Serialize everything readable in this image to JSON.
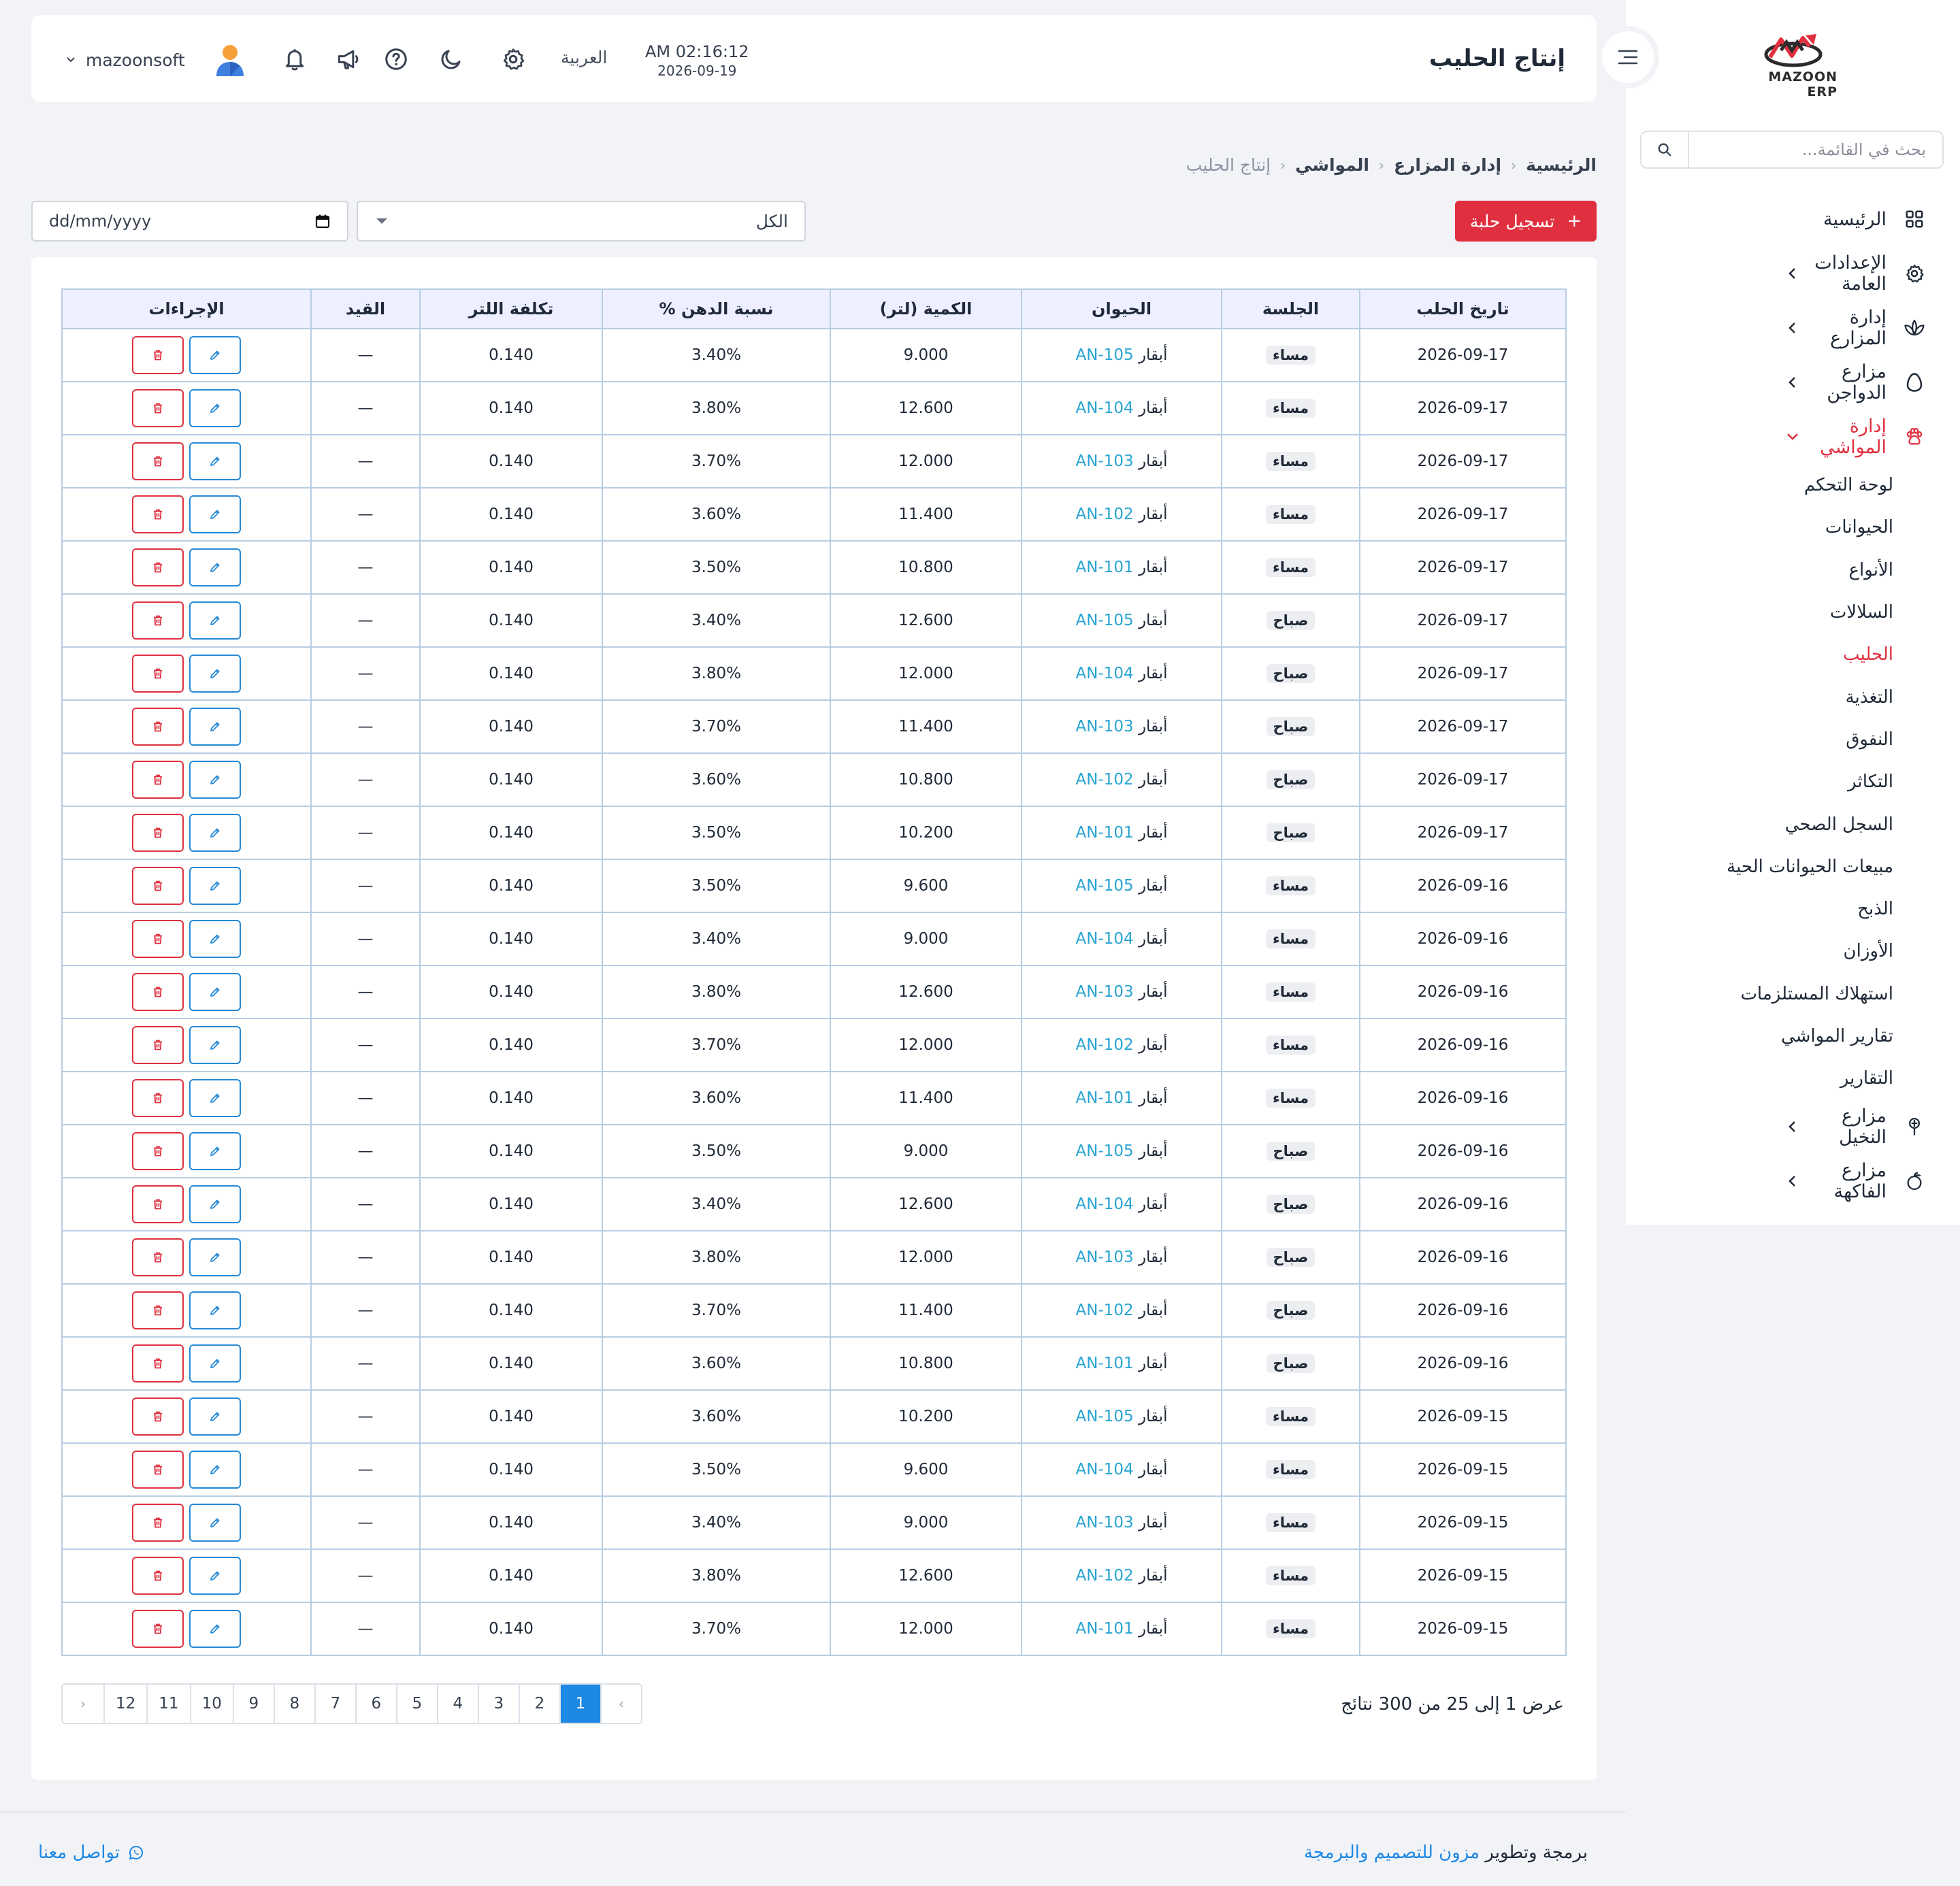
{
  "brand": {
    "logo_text": "MAZOON ERP"
  },
  "header": {
    "title": "إنتاج الحليب",
    "time": "AM 02:16:12",
    "date": "2026-09-19",
    "language": "العربية",
    "username": "mazoonsoft"
  },
  "sidebar": {
    "search_placeholder": "بحث في القائمة...",
    "items": [
      {
        "label": "الرئيسية",
        "icon": "grid-icon"
      },
      {
        "label": "الإعدادات العامة",
        "icon": "gear-icon"
      },
      {
        "label": "إدارة المزارع",
        "icon": "plant-icon"
      },
      {
        "label": "مزارع الدواجن",
        "icon": "egg-icon"
      },
      {
        "label": "إدارة المواشي",
        "icon": "paw-icon"
      },
      {
        "label": "مزارع النخيل",
        "icon": "palm-icon"
      },
      {
        "label": "مزارع الفاكهة",
        "icon": "fruit-icon"
      }
    ],
    "subitems": [
      "لوحة التحكم",
      "الحيوانات",
      "الأنواع",
      "السلالات",
      "الحليب",
      "التغذية",
      "النفوق",
      "التكاثر",
      "السجل الصحي",
      "مبيعات الحيوانات الحية",
      "الذبح",
      "الأوزان",
      "استهلاك المستلزمات",
      "تقارير المواشي",
      "التقارير"
    ],
    "active_subitem": "الحليب"
  },
  "breadcrumb": [
    "الرئيسية",
    "إدارة المزارع",
    "المواشي",
    "إنتاج الحليب"
  ],
  "toolbar": {
    "add_button": "تسجيل حلبة",
    "filter_value": "الكل",
    "date_placeholder": "dd/mm/yyyy"
  },
  "table": {
    "headers": [
      "تاريخ الحلب",
      "الجلسة",
      "الحيوان",
      "الكمية (لتر)",
      "نسبة الدهن %",
      "تكلفة اللتر",
      "القيد",
      "الإجراءات"
    ],
    "animal_prefix": "أبقار",
    "rows": [
      [
        "2026-09-17",
        "مساء",
        "AN-105",
        "9.000",
        "3.40%",
        "0.140",
        "—"
      ],
      [
        "2026-09-17",
        "مساء",
        "AN-104",
        "12.600",
        "3.80%",
        "0.140",
        "—"
      ],
      [
        "2026-09-17",
        "مساء",
        "AN-103",
        "12.000",
        "3.70%",
        "0.140",
        "—"
      ],
      [
        "2026-09-17",
        "مساء",
        "AN-102",
        "11.400",
        "3.60%",
        "0.140",
        "—"
      ],
      [
        "2026-09-17",
        "مساء",
        "AN-101",
        "10.800",
        "3.50%",
        "0.140",
        "—"
      ],
      [
        "2026-09-17",
        "صباح",
        "AN-105",
        "12.600",
        "3.40%",
        "0.140",
        "—"
      ],
      [
        "2026-09-17",
        "صباح",
        "AN-104",
        "12.000",
        "3.80%",
        "0.140",
        "—"
      ],
      [
        "2026-09-17",
        "صباح",
        "AN-103",
        "11.400",
        "3.70%",
        "0.140",
        "—"
      ],
      [
        "2026-09-17",
        "صباح",
        "AN-102",
        "10.800",
        "3.60%",
        "0.140",
        "—"
      ],
      [
        "2026-09-17",
        "صباح",
        "AN-101",
        "10.200",
        "3.50%",
        "0.140",
        "—"
      ],
      [
        "2026-09-16",
        "مساء",
        "AN-105",
        "9.600",
        "3.50%",
        "0.140",
        "—"
      ],
      [
        "2026-09-16",
        "مساء",
        "AN-104",
        "9.000",
        "3.40%",
        "0.140",
        "—"
      ],
      [
        "2026-09-16",
        "مساء",
        "AN-103",
        "12.600",
        "3.80%",
        "0.140",
        "—"
      ],
      [
        "2026-09-16",
        "مساء",
        "AN-102",
        "12.000",
        "3.70%",
        "0.140",
        "—"
      ],
      [
        "2026-09-16",
        "مساء",
        "AN-101",
        "11.400",
        "3.60%",
        "0.140",
        "—"
      ],
      [
        "2026-09-16",
        "صباح",
        "AN-105",
        "9.000",
        "3.50%",
        "0.140",
        "—"
      ],
      [
        "2026-09-16",
        "صباح",
        "AN-104",
        "12.600",
        "3.40%",
        "0.140",
        "—"
      ],
      [
        "2026-09-16",
        "صباح",
        "AN-103",
        "12.000",
        "3.80%",
        "0.140",
        "—"
      ],
      [
        "2026-09-16",
        "صباح",
        "AN-102",
        "11.400",
        "3.70%",
        "0.140",
        "—"
      ],
      [
        "2026-09-16",
        "صباح",
        "AN-101",
        "10.800",
        "3.60%",
        "0.140",
        "—"
      ],
      [
        "2026-09-15",
        "مساء",
        "AN-105",
        "10.200",
        "3.60%",
        "0.140",
        "—"
      ],
      [
        "2026-09-15",
        "مساء",
        "AN-104",
        "9.600",
        "3.50%",
        "0.140",
        "—"
      ],
      [
        "2026-09-15",
        "مساء",
        "AN-103",
        "9.000",
        "3.40%",
        "0.140",
        "—"
      ],
      [
        "2026-09-15",
        "مساء",
        "AN-102",
        "12.600",
        "3.80%",
        "0.140",
        "—"
      ],
      [
        "2026-09-15",
        "مساء",
        "AN-101",
        "12.000",
        "3.70%",
        "0.140",
        "—"
      ]
    ]
  },
  "pagination": {
    "summary": "عرض 1 إلى 25 من 300 نتائج",
    "prev": "‹",
    "next": "›",
    "pages": [
      "1",
      "2",
      "3",
      "4",
      "5",
      "6",
      "7",
      "8",
      "9",
      "10",
      "11",
      "12"
    ],
    "current": "1"
  },
  "footer": {
    "credit_prefix": "برمجة وتطوير",
    "credit_brand": "مزون للتصميم والبرمجة",
    "contact": "تواصل معنا"
  },
  "colors": {
    "accent_red": "#e0303f",
    "accent_blue": "#1e88e5",
    "link_cyan": "#29a4d3",
    "table_border": "#b7cde3",
    "header_bg": "#eef0ff"
  }
}
